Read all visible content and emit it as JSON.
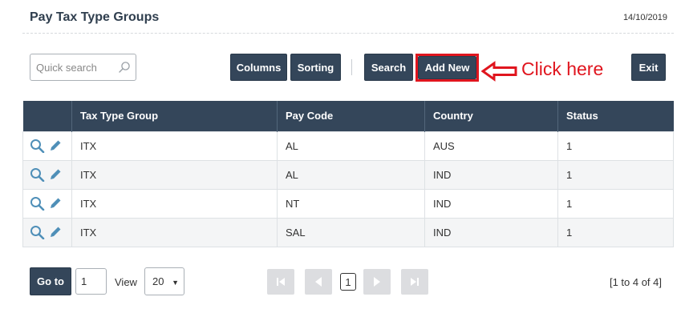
{
  "header": {
    "title": "Pay Tax Type Groups",
    "date": "14/10/2019"
  },
  "search": {
    "placeholder": "Quick search",
    "value": ""
  },
  "toolbar": {
    "columns_label": "Columns",
    "sorting_label": "Sorting",
    "search_label": "Search",
    "add_new_label": "Add New",
    "exit_label": "Exit"
  },
  "annotation": {
    "text": "Click here",
    "color": "#e0151e"
  },
  "table": {
    "columns": [
      "Tax Type Group",
      "Pay Code",
      "Country",
      "Status"
    ],
    "rows": [
      [
        "ITX",
        "AL",
        "AUS",
        "1"
      ],
      [
        "ITX",
        "AL",
        "IND",
        "1"
      ],
      [
        "ITX",
        "NT",
        "IND",
        "1"
      ],
      [
        "ITX",
        "SAL",
        "IND",
        "1"
      ]
    ]
  },
  "footer": {
    "goto_label": "Go to",
    "goto_value": "1",
    "view_label": "View",
    "page_size": "20",
    "current_page": "1",
    "record_info": "[1 to 4 of 4]"
  },
  "icons": {
    "search": "search-icon",
    "view_row": "magnifier-icon",
    "edit_row": "pencil-icon",
    "first": "first-page-icon",
    "prev": "prev-page-icon",
    "next": "next-page-icon",
    "last": "last-page-icon"
  },
  "colors": {
    "primary": "#34465a",
    "accent_icon": "#4f8fb8",
    "highlight": "#e0151e"
  }
}
